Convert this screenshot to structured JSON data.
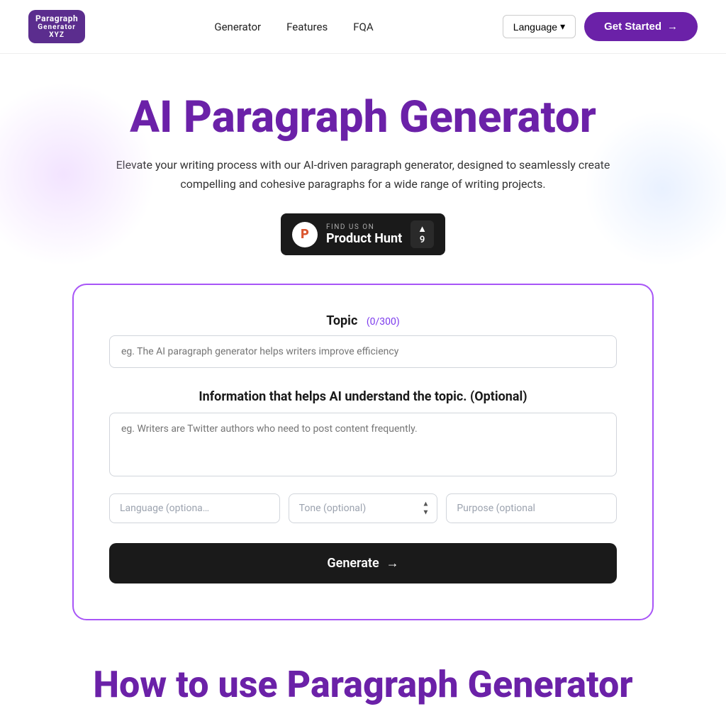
{
  "nav": {
    "logo_line1": "Paragraph",
    "logo_line2": "Generator",
    "logo_line3": "XYZ",
    "links": [
      {
        "label": "Generator",
        "href": "#"
      },
      {
        "label": "Features",
        "href": "#"
      },
      {
        "label": "FQA",
        "href": "#"
      }
    ],
    "language_label": "Language",
    "language_arrow": "▾",
    "get_started": "Get Started",
    "get_started_arrow": "→"
  },
  "hero": {
    "title": "AI Paragraph Generator",
    "subtitle": "Elevate your writing process with our AI-driven paragraph generator, designed to seamlessly create compelling and cohesive paragraphs for a wide range of writing projects.",
    "ph_find": "FIND US ON",
    "ph_name": "Product Hunt",
    "ph_logo_letter": "P",
    "ph_vote_arrow": "▲",
    "ph_vote_count": "9"
  },
  "form": {
    "topic_label": "Topic",
    "topic_char_count": "(0/300)",
    "topic_placeholder": "eg. The AI paragraph generator helps writers improve efficiency",
    "info_label": "Information that helps AI understand the topic. (Optional)",
    "info_placeholder": "eg. Writers are Twitter authors who need to post content frequently.",
    "language_placeholder": "Language (optiona…",
    "tone_placeholder": "Tone (optional)",
    "purpose_placeholder": "Purpose (optional",
    "generate_label": "Generate",
    "generate_arrow": "→"
  },
  "bottom": {
    "title": "How to use Paragraph Generator"
  }
}
